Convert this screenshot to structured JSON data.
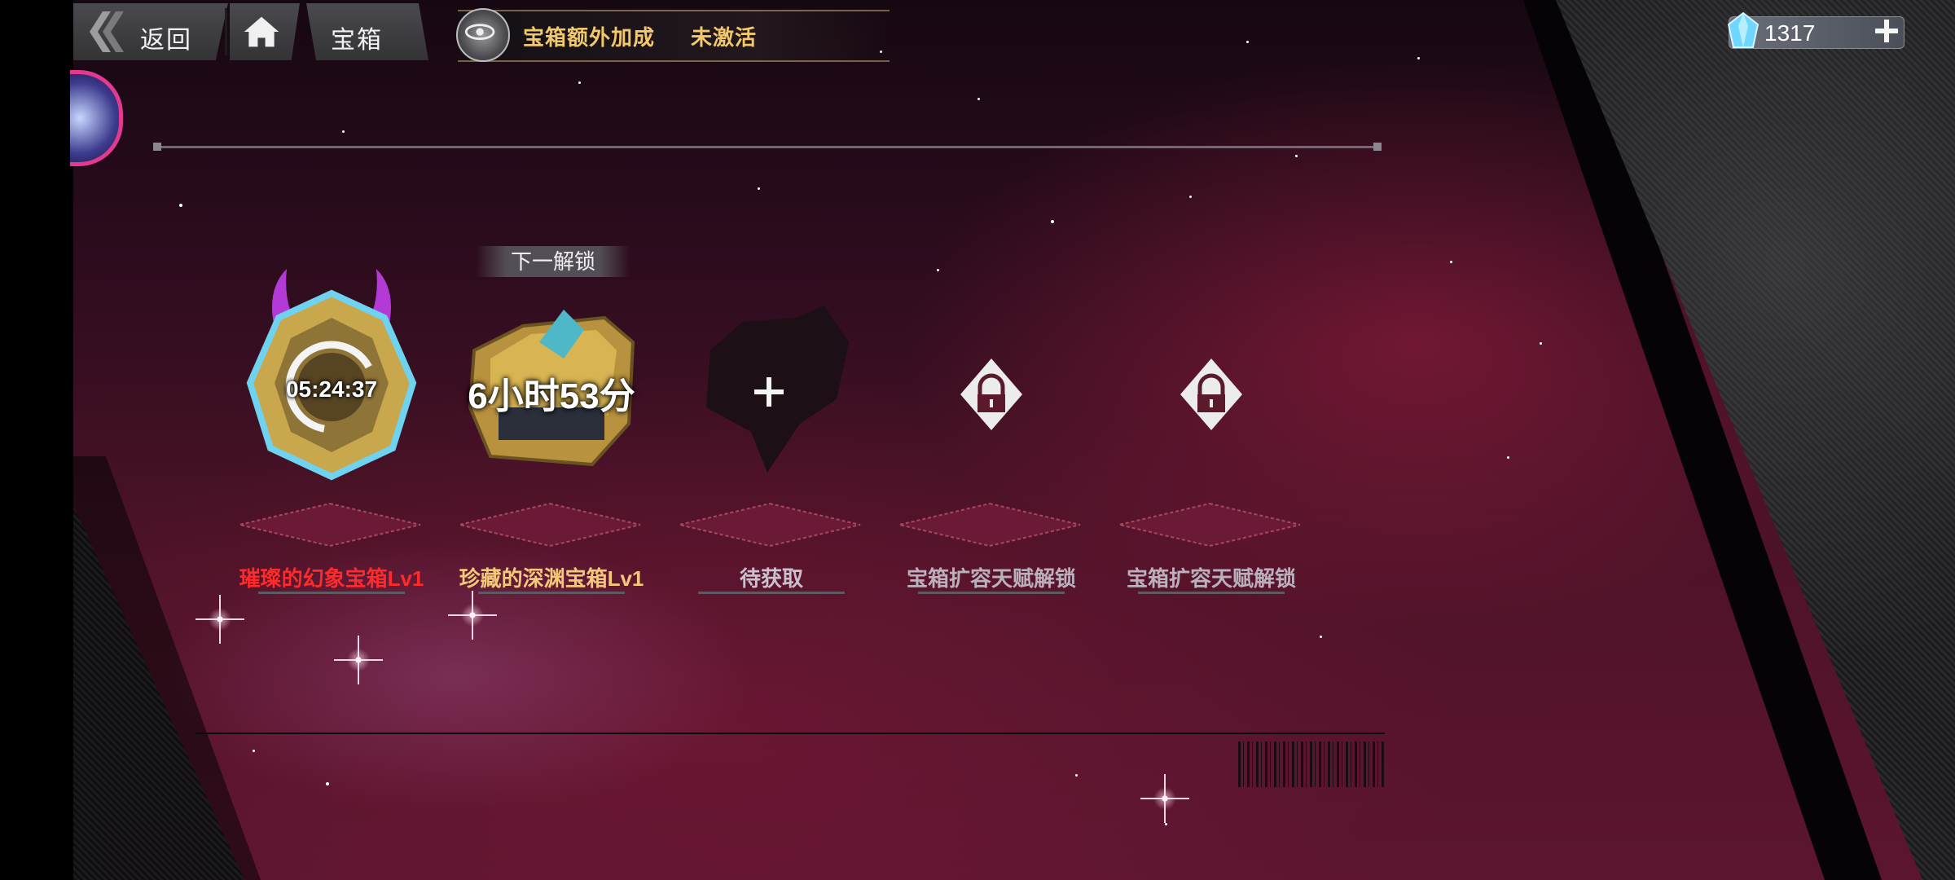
{
  "nav": {
    "back_label": "返回",
    "page_tab_label": "宝箱"
  },
  "bonus": {
    "label": "宝箱额外加成",
    "status": "未激活"
  },
  "currency": {
    "value": "1317",
    "icon": "crystal-icon"
  },
  "next_unlock_label": "下一解锁",
  "slots": [
    {
      "state": "unlocking",
      "timer": "05:24:37",
      "label": "璀璨的幻象宝箱Lv1",
      "label_color": "#ff2a2a"
    },
    {
      "state": "locked-chest",
      "timer": "6小时53分",
      "label": "珍藏的深渊宝箱Lv1",
      "label_color": "#f3c978"
    },
    {
      "state": "empty",
      "label": "待获取",
      "label_color": "#c9c2cc",
      "icon": "plus-icon"
    },
    {
      "state": "locked-slot",
      "label": "宝箱扩容天赋解锁",
      "label_color": "#b9b2bd",
      "icon": "lock-icon"
    },
    {
      "state": "locked-slot",
      "label": "宝箱扩容天赋解锁",
      "label_color": "#b9b2bd",
      "icon": "lock-icon"
    }
  ],
  "colors": {
    "gold_text": "#f2c96a",
    "red_label": "#ff2a2a",
    "gold_label": "#f3c978",
    "background_accent": "#5c1530"
  }
}
